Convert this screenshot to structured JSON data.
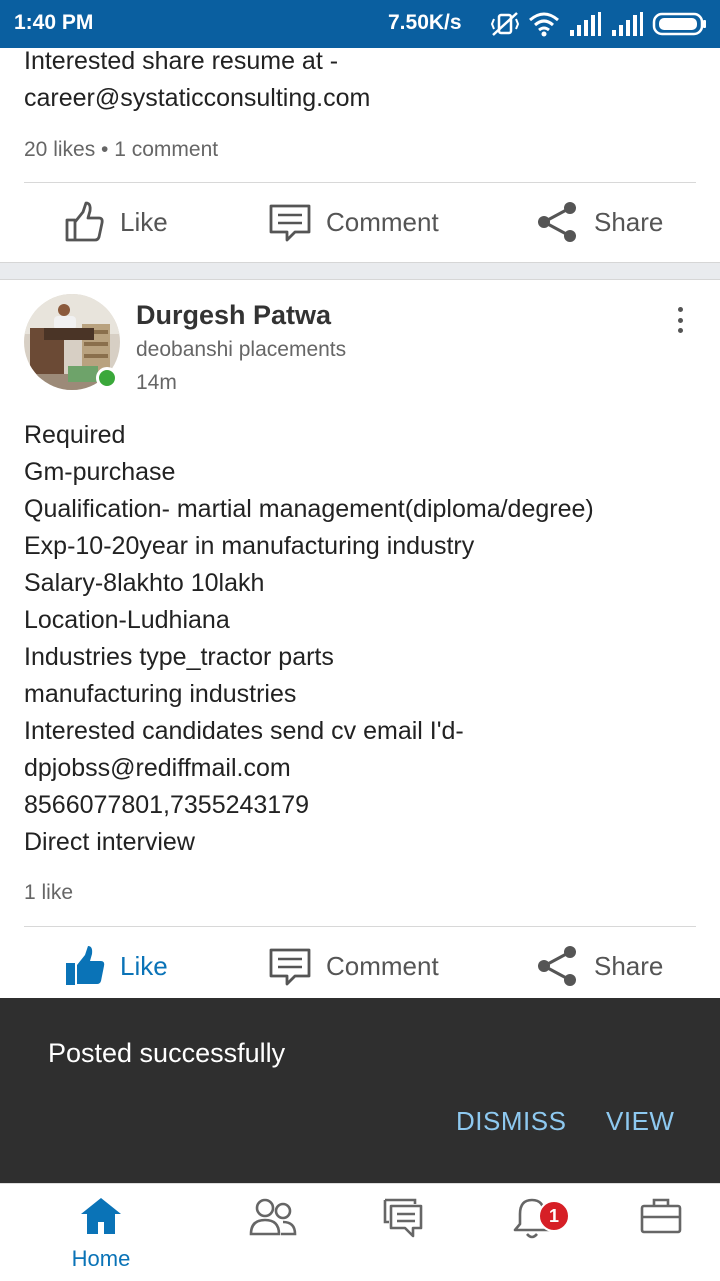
{
  "status_bar": {
    "time": "1:40 PM",
    "network_speed": "7.50K/s",
    "icons": [
      "vibrate-off-icon",
      "wifi-icon",
      "signal-icon",
      "signal-icon",
      "battery-icon"
    ]
  },
  "prev_post": {
    "text": "Interested share resume at -\ncareer@systaticconsulting.com",
    "stats": "20 likes • 1 comment",
    "actions": {
      "like": "Like",
      "comment": "Comment",
      "share": "Share"
    }
  },
  "post": {
    "author_name": "Durgesh Patwa",
    "author_subtitle": "deobanshi placements",
    "time": "14m",
    "body": "Required\nGm-purchase\nQualification- martial management(diploma/degree)\nExp-10-20year in manufacturing industry\nSalary-8lakhto 10lakh\nLocation-Ludhiana\nIndustries type_tractor parts\nmanufacturing industries\nInterested candidates send cv email I'd-\ndpjobss@rediffmail.com\n8566077801,7355243179\nDirect interview",
    "stats": "1 like",
    "actions": {
      "like": "Like",
      "comment": "Comment",
      "share": "Share"
    },
    "liked": true
  },
  "snackbar": {
    "message": "Posted successfully",
    "dismiss": "DISMISS",
    "view": "VIEW"
  },
  "bottom_nav": {
    "home_label": "Home",
    "notification_count": "1",
    "items": [
      "home-icon",
      "network-icon",
      "messaging-icon",
      "notifications-icon",
      "jobs-icon"
    ]
  },
  "colors": {
    "status_bar": "#0a5fa0",
    "accent": "#0a73b7",
    "snackbar_bg": "#2f2f2f",
    "snackbar_action": "#8ec9f0",
    "badge": "#d61f26",
    "online": "#3aa83a"
  }
}
